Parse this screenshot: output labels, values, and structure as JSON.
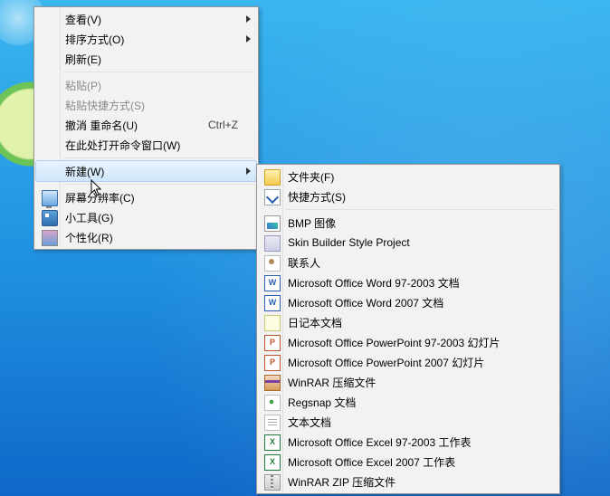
{
  "main_menu": {
    "items": [
      {
        "kind": "item",
        "label": "查看(V)",
        "arrow": true,
        "name": "menu-view"
      },
      {
        "kind": "item",
        "label": "排序方式(O)",
        "arrow": true,
        "name": "menu-sort-by"
      },
      {
        "kind": "item",
        "label": "刷新(E)",
        "name": "menu-refresh"
      },
      {
        "kind": "sep"
      },
      {
        "kind": "item",
        "label": "粘贴(P)",
        "disabled": true,
        "name": "menu-paste"
      },
      {
        "kind": "item",
        "label": "粘贴快捷方式(S)",
        "disabled": true,
        "name": "menu-paste-shortcut"
      },
      {
        "kind": "item",
        "label": "撤消 重命名(U)",
        "accel": "Ctrl+Z",
        "name": "menu-undo-rename"
      },
      {
        "kind": "item",
        "label": "在此处打开命令窗口(W)",
        "name": "menu-open-cmd-here"
      },
      {
        "kind": "sep"
      },
      {
        "kind": "item",
        "label": "新建(W)",
        "arrow": true,
        "highlight": true,
        "name": "menu-new"
      },
      {
        "kind": "sep"
      },
      {
        "kind": "item",
        "label": "屏幕分辨率(C)",
        "icon": "ic-monitor",
        "icon_name": "monitor-icon",
        "name": "menu-screen-resolution"
      },
      {
        "kind": "item",
        "label": "小工具(G)",
        "icon": "ic-gadget",
        "icon_name": "gadget-icon",
        "name": "menu-gadgets"
      },
      {
        "kind": "item",
        "label": "个性化(R)",
        "icon": "ic-personal",
        "icon_name": "personalize-icon",
        "name": "menu-personalize"
      }
    ]
  },
  "sub_menu": {
    "items": [
      {
        "kind": "item",
        "label": "文件夹(F)",
        "icon": "ic-folder",
        "icon_name": "folder-icon",
        "name": "new-folder"
      },
      {
        "kind": "item",
        "label": "快捷方式(S)",
        "icon": "ic-shortcut",
        "icon_name": "shortcut-icon",
        "name": "new-shortcut"
      },
      {
        "kind": "sep"
      },
      {
        "kind": "item",
        "label": "BMP 图像",
        "icon": "ic-bmp",
        "icon_name": "bmp-icon",
        "name": "new-bmp-image"
      },
      {
        "kind": "item",
        "label": "Skin Builder Style Project",
        "icon": "ic-skin",
        "icon_name": "skin-project-icon",
        "name": "new-skin-builder-project"
      },
      {
        "kind": "item",
        "label": "联系人",
        "icon": "ic-contact",
        "icon_name": "contact-icon",
        "name": "new-contact"
      },
      {
        "kind": "item",
        "label": "Microsoft Office Word 97-2003 文档",
        "icon": "ic-word",
        "icon_text": "W",
        "icon_name": "word-doc-icon",
        "name": "new-word-97-2003"
      },
      {
        "kind": "item",
        "label": "Microsoft Office Word 2007 文档",
        "icon": "ic-word",
        "icon_text": "W",
        "icon_name": "word-docx-icon",
        "name": "new-word-2007"
      },
      {
        "kind": "item",
        "label": "日记本文档",
        "icon": "ic-note",
        "icon_name": "journal-icon",
        "name": "new-journal"
      },
      {
        "kind": "item",
        "label": "Microsoft Office PowerPoint 97-2003 幻灯片",
        "icon": "ic-ppt",
        "icon_text": "P",
        "icon_name": "powerpoint-ppt-icon",
        "name": "new-ppt-97-2003"
      },
      {
        "kind": "item",
        "label": "Microsoft Office PowerPoint 2007 幻灯片",
        "icon": "ic-ppt",
        "icon_text": "P",
        "icon_name": "powerpoint-pptx-icon",
        "name": "new-ppt-2007"
      },
      {
        "kind": "item",
        "label": "WinRAR 压缩文件",
        "icon": "ic-rar",
        "icon_name": "winrar-icon",
        "name": "new-winrar-archive"
      },
      {
        "kind": "item",
        "label": "Regsnap 文档",
        "icon": "ic-reg",
        "icon_name": "regsnap-icon",
        "name": "new-regsnap"
      },
      {
        "kind": "item",
        "label": "文本文档",
        "icon": "ic-txt",
        "icon_name": "text-file-icon",
        "name": "new-text-document"
      },
      {
        "kind": "item",
        "label": "Microsoft Office Excel 97-2003 工作表",
        "icon": "ic-excel",
        "icon_text": "X",
        "icon_name": "excel-xls-icon",
        "name": "new-excel-97-2003"
      },
      {
        "kind": "item",
        "label": "Microsoft Office Excel 2007 工作表",
        "icon": "ic-excel",
        "icon_text": "X",
        "icon_name": "excel-xlsx-icon",
        "name": "new-excel-2007"
      },
      {
        "kind": "item",
        "label": "WinRAR ZIP 压缩文件",
        "icon": "ic-zip",
        "icon_name": "winrar-zip-icon",
        "name": "new-winrar-zip"
      }
    ]
  }
}
